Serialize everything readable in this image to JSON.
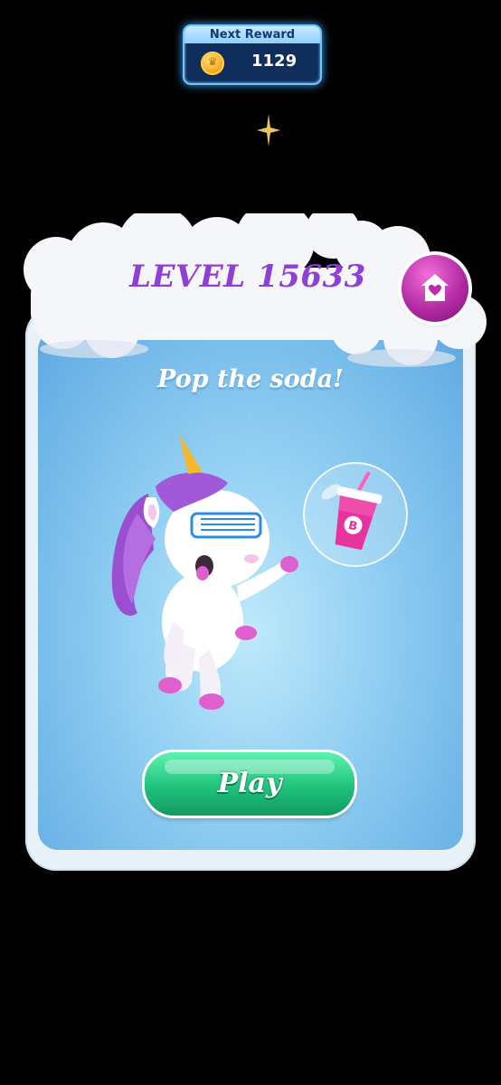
{
  "reward": {
    "title": "Next Reward",
    "amount": "1129"
  },
  "level": {
    "title": "LEVEL 15633",
    "objective": "Pop the soda!"
  },
  "actions": {
    "play_label": "Play"
  },
  "icons": {
    "coin": "coin-icon",
    "home": "heart-house-icon",
    "sparkle": "sparkle-icon",
    "soda": "soda-cup-icon"
  },
  "colors": {
    "title": "#8d3fd6",
    "play": "#1fc27d",
    "home_button": "#b52ba5",
    "card_inner": "#8fcdf2"
  }
}
